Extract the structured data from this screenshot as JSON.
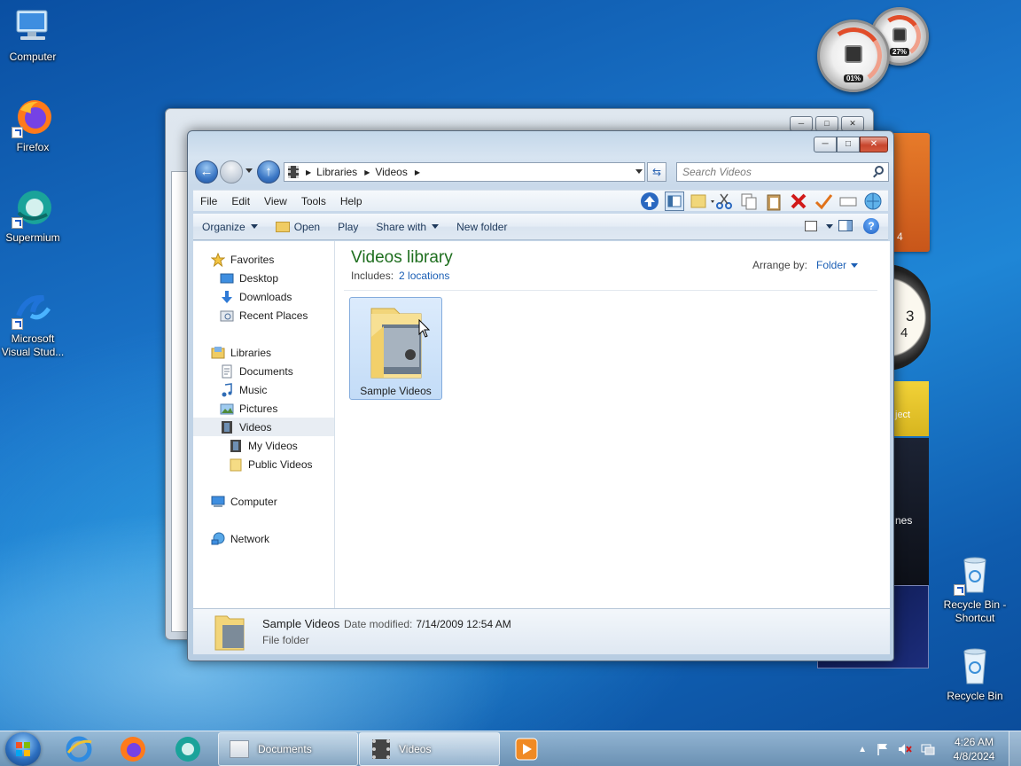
{
  "desktop": {
    "icons": [
      {
        "label": "Computer"
      },
      {
        "label": "Firefox"
      },
      {
        "label": "Supermium"
      },
      {
        "label": "Microsoft Visual Stud..."
      },
      {
        "label": "Recycle Bin - Shortcut"
      },
      {
        "label": "Recycle Bin"
      }
    ],
    "gadgets": {
      "cpu_percent": "01%",
      "mem_percent": "27%",
      "clock_numbers": [
        "3",
        "4"
      ],
      "calendar_fragment": "4",
      "fragment_1": "ject",
      "fragment_2": "nes"
    }
  },
  "window": {
    "address": {
      "segments": [
        "Libraries",
        "Videos"
      ]
    },
    "search": {
      "placeholder": "Search Videos"
    },
    "menu": [
      "File",
      "Edit",
      "View",
      "Tools",
      "Help"
    ],
    "commands": {
      "organize": "Organize",
      "open": "Open",
      "play": "Play",
      "share_with": "Share with",
      "new_folder": "New folder"
    },
    "nav": {
      "favorites": "Favorites",
      "desktop": "Desktop",
      "downloads": "Downloads",
      "recent_places": "Recent Places",
      "libraries": "Libraries",
      "documents": "Documents",
      "music": "Music",
      "pictures": "Pictures",
      "videos": "Videos",
      "my_videos": "My Videos",
      "public_videos": "Public Videos",
      "computer": "Computer",
      "network": "Network"
    },
    "library": {
      "title": "Videos library",
      "includes_label": "Includes:",
      "includes_link": "2 locations",
      "arrange_label": "Arrange by:",
      "arrange_value": "Folder"
    },
    "items": [
      {
        "name": "Sample Videos"
      }
    ],
    "details": {
      "name": "Sample Videos",
      "modified_label": "Date modified:",
      "modified_value": "7/14/2009 12:54 AM",
      "type": "File folder"
    },
    "colors": {
      "accent": "#1e6e1e",
      "link": "#1b5fb5"
    }
  },
  "taskbar": {
    "tasks": [
      {
        "label": "Documents"
      },
      {
        "label": "Videos"
      }
    ],
    "clock": {
      "time": "4:26 AM",
      "date": "4/8/2024"
    }
  }
}
